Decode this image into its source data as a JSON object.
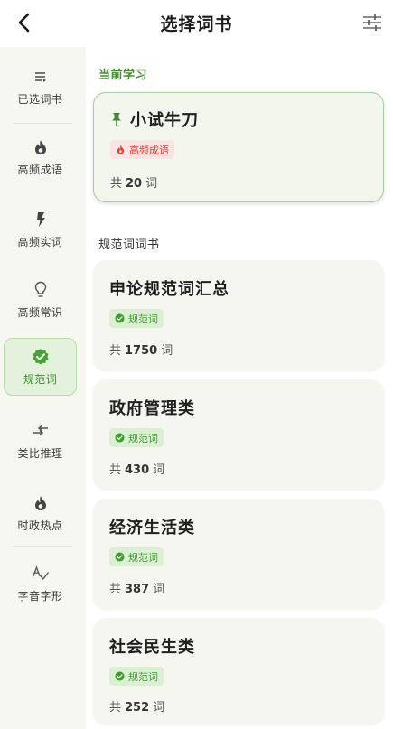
{
  "header": {
    "title": "选择词书"
  },
  "sidebar": {
    "items": [
      {
        "label": "已选词书",
        "icon": "list-icon"
      },
      {
        "label": "高频成语",
        "icon": "flame-icon"
      },
      {
        "label": "高频实词",
        "icon": "bolt-icon"
      },
      {
        "label": "高频常识",
        "icon": "bulb-icon"
      },
      {
        "label": "规范词",
        "icon": "badge-check-icon",
        "active": true
      },
      {
        "label": "类比推理",
        "icon": "swap-icon"
      },
      {
        "label": "时政热点",
        "icon": "flame-icon"
      },
      {
        "label": "字音字形",
        "icon": "spell-check-icon"
      }
    ]
  },
  "current": {
    "section_label": "当前学习",
    "book": {
      "title": "小试牛刀",
      "tag": "高频成语",
      "count_prefix": "共",
      "count": "20",
      "count_suffix": "词"
    }
  },
  "books_section": {
    "label": "规范词词书",
    "books": [
      {
        "title": "申论规范词汇总",
        "tag": "规范词",
        "count_prefix": "共",
        "count": "1750",
        "count_suffix": "词"
      },
      {
        "title": "政府管理类",
        "tag": "规范词",
        "count_prefix": "共",
        "count": "430",
        "count_suffix": "词"
      },
      {
        "title": "经济生活类",
        "tag": "规范词",
        "count_prefix": "共",
        "count": "387",
        "count_suffix": "词"
      },
      {
        "title": "社会民生类",
        "tag": "规范词",
        "count_prefix": "共",
        "count": "252",
        "count_suffix": "词"
      }
    ]
  },
  "colors": {
    "accent": "#4a8b36",
    "hot_tag": "#e2423a",
    "std_tag": "#3f9c2f",
    "sidebar_bg": "#f6f7f1"
  }
}
